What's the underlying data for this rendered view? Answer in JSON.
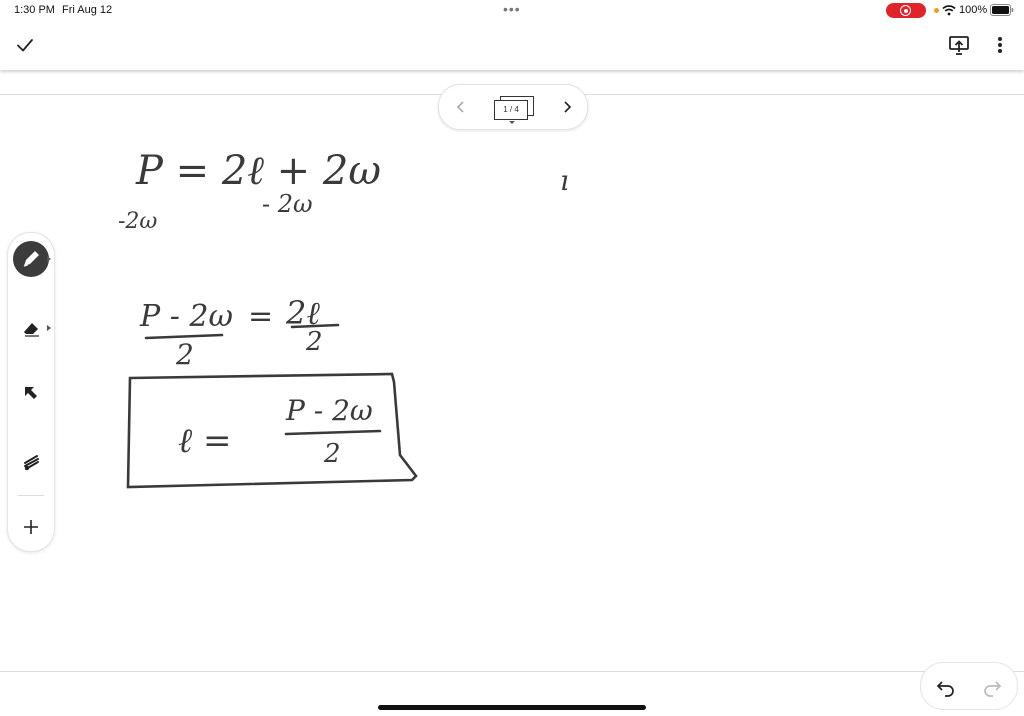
{
  "status_bar": {
    "time": "1:30 PM",
    "date": "Fri Aug 12",
    "battery": "100%",
    "record_color": "#e0242b"
  },
  "toolbar": {
    "check_icon": "check-icon",
    "present_icon": "present-icon",
    "more_icon": "more-vertical-icon"
  },
  "page_navigator": {
    "current": "1 / 4",
    "prev_icon": "chevron-left-icon",
    "next_icon": "chevron-right-icon"
  },
  "tools": [
    {
      "name": "pen",
      "icon": "pen-icon",
      "selected": true
    },
    {
      "name": "eraser",
      "icon": "eraser-icon"
    },
    {
      "name": "select",
      "icon": "select-arrow-icon"
    },
    {
      "name": "laser",
      "icon": "laser-pointer-icon"
    },
    {
      "name": "add",
      "icon": "plus-icon"
    }
  ],
  "history": {
    "undo_icon": "undo-icon",
    "redo_icon": "redo-icon"
  },
  "ink": {
    "line1": "P = 2ℓ + 2ω",
    "line2_left": "-2ω",
    "line2_right": "- 2ω",
    "line3_lhs_num": "P - 2ω",
    "line3_lhs_den": "2",
    "line3_eq": "=",
    "line3_rhs_num": "2ℓ",
    "line3_rhs_den": "2",
    "answer_lhs": "ℓ =",
    "answer_num": "P - 2ω",
    "answer_den": "2",
    "stray_mark": "ı"
  }
}
